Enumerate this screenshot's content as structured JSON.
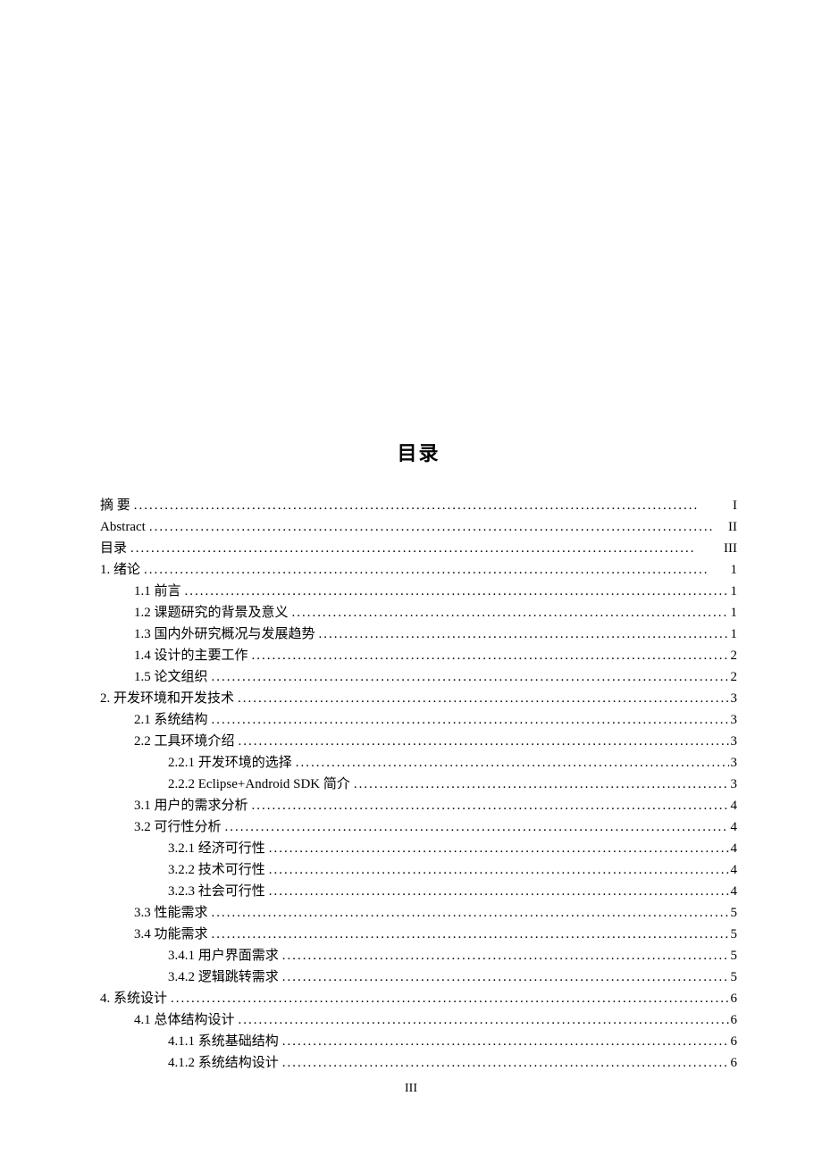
{
  "title": "目录",
  "page_number": "III",
  "toc": [
    {
      "level": 0,
      "label": "摘 要",
      "page": "I"
    },
    {
      "level": 0,
      "label": "Abstract",
      "page": "II"
    },
    {
      "level": 0,
      "label": "目录",
      "page": "III"
    },
    {
      "level": 0,
      "label": "1. 绪论",
      "page": "1"
    },
    {
      "level": 1,
      "label": "1.1 前言",
      "page": "1"
    },
    {
      "level": 1,
      "label": "1.2 课题研究的背景及意义",
      "page": "1"
    },
    {
      "level": 1,
      "label": "1.3 国内外研究概况与发展趋势",
      "page": "1"
    },
    {
      "level": 1,
      "label": "1.4 设计的主要工作",
      "page": "2"
    },
    {
      "level": 1,
      "label": "1.5 论文组织",
      "page": "2"
    },
    {
      "level": 0,
      "label": "2. 开发环境和开发技术",
      "page": "3"
    },
    {
      "level": 1,
      "label": "2.1 系统结构",
      "page": "3"
    },
    {
      "level": 1,
      "label": "2.2 工具环境介绍",
      "page": "3"
    },
    {
      "level": 2,
      "label": "2.2.1 开发环境的选择",
      "page": "3"
    },
    {
      "level": 2,
      "label": "2.2.2 Eclipse+Android SDK 简介",
      "page": "3"
    },
    {
      "level": 1,
      "label": "3.1 用户的需求分析",
      "page": "4"
    },
    {
      "level": 1,
      "label": "3.2 可行性分析",
      "page": "4"
    },
    {
      "level": 2,
      "label": "3.2.1 经济可行性",
      "page": "4"
    },
    {
      "level": 2,
      "label": "3.2.2 技术可行性",
      "page": "4"
    },
    {
      "level": 2,
      "label": "3.2.3 社会可行性",
      "page": "4"
    },
    {
      "level": 1,
      "label": "3.3 性能需求",
      "page": "5"
    },
    {
      "level": 1,
      "label": "3.4 功能需求",
      "page": "5"
    },
    {
      "level": 2,
      "label": "3.4.1 用户界面需求",
      "page": "5"
    },
    {
      "level": 2,
      "label": "3.4.2 逻辑跳转需求",
      "page": "5"
    },
    {
      "level": 0,
      "label": "4. 系统设计",
      "page": "6"
    },
    {
      "level": 1,
      "label": "4.1 总体结构设计",
      "page": "6"
    },
    {
      "level": 2,
      "label": "4.1.1 系统基础结构",
      "page": "6"
    },
    {
      "level": 2,
      "label": "4.1.2 系统结构设计",
      "page": "6"
    }
  ]
}
